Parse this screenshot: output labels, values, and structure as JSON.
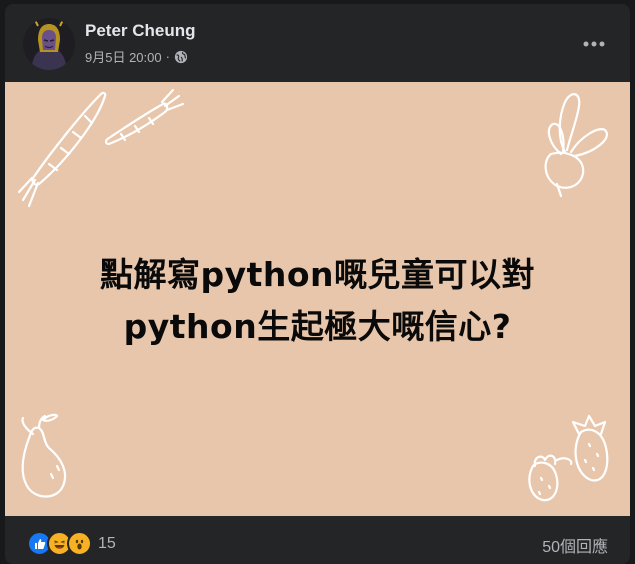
{
  "post": {
    "author": "Peter Cheung",
    "date": "9月5日 20:00",
    "separator": "·",
    "privacy_icon": "globe-icon",
    "menu_icon": "more-options-icon",
    "image": {
      "background": "#e8c6ab",
      "text_line_1": "點解寫python嘅兒童可以對",
      "text_line_2": "python生起極大嘅信心?",
      "decorations": [
        "carrot-icon",
        "radish-icon",
        "pear-icon",
        "strawberry-icon"
      ]
    }
  },
  "footer": {
    "reactions": [
      "like-icon",
      "haha-icon",
      "wow-icon"
    ],
    "reaction_count": "15",
    "comments_label": "50個回應"
  },
  "colors": {
    "card": "#242526",
    "page": "#18191a",
    "primary_text": "#e4e6eb",
    "secondary_text": "#b0b3b8",
    "like_blue": "#1877f2",
    "emoji_yellow": "#f7b125"
  }
}
